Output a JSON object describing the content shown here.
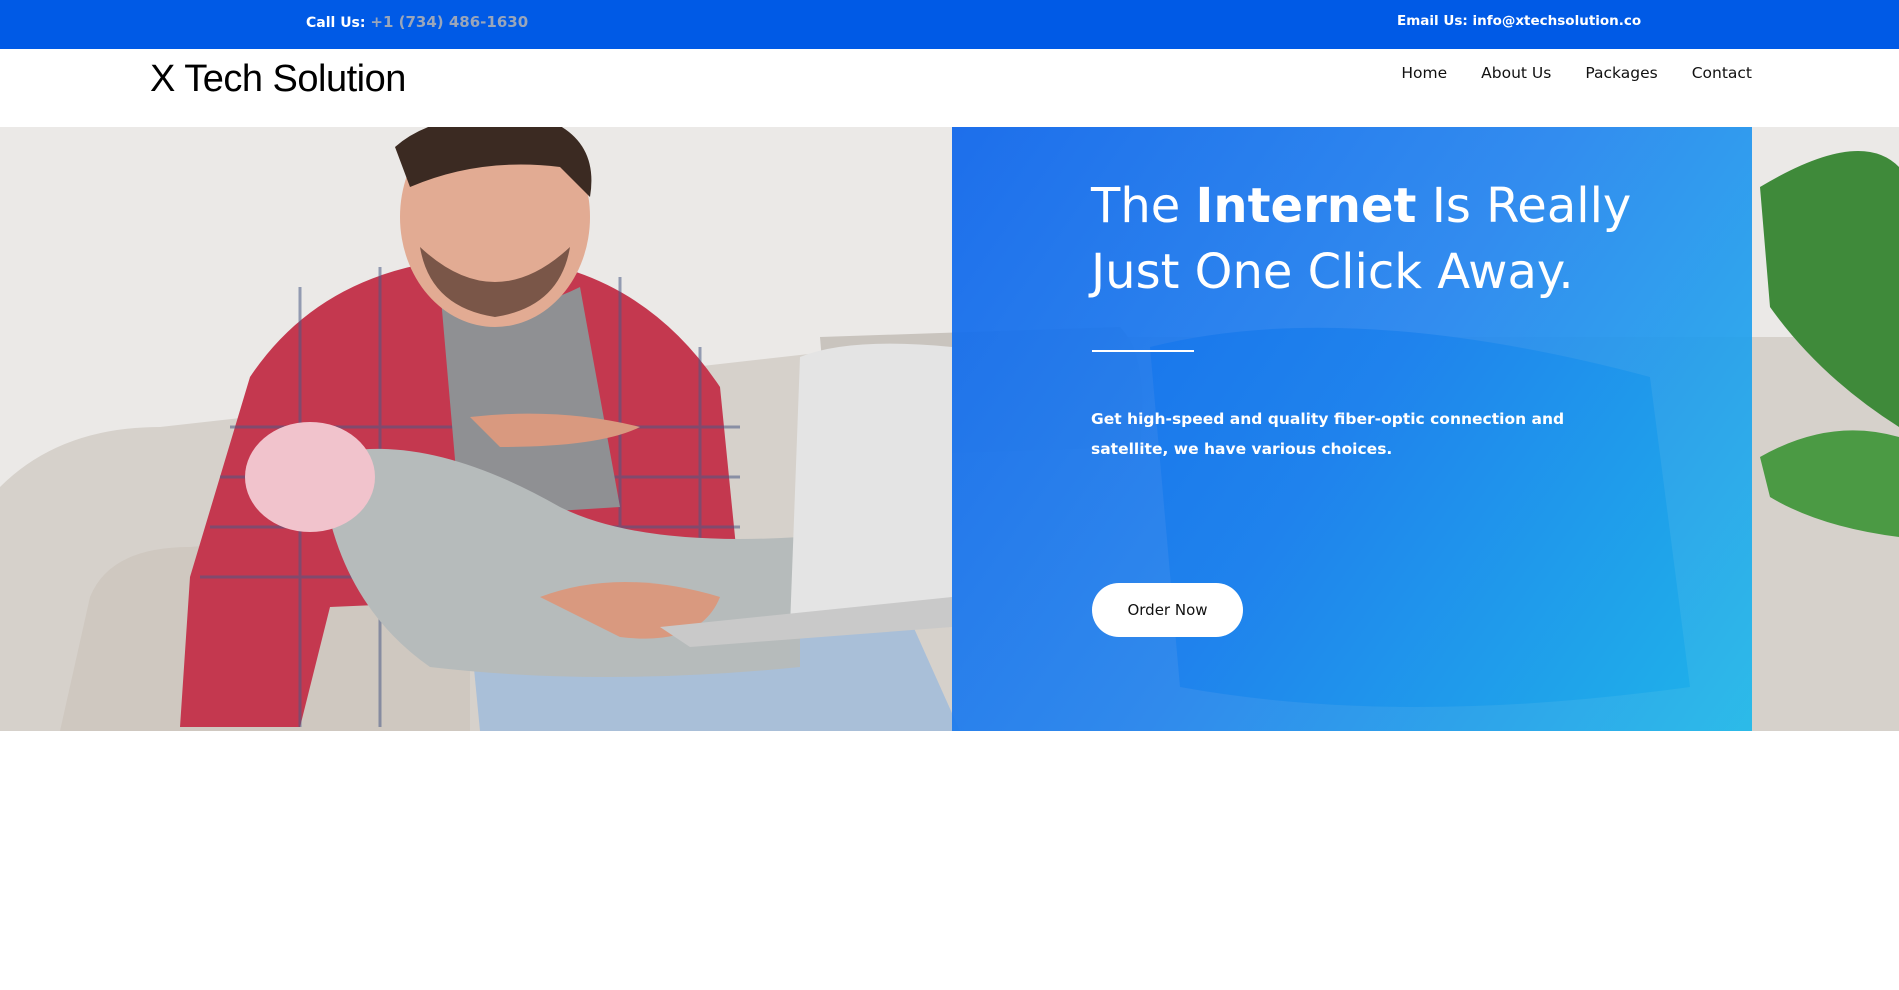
{
  "topbar": {
    "call_label": "Call Us:",
    "phone": "+1 (734) 486-1630",
    "email_label": "Email Us:",
    "email": "info@xtechsolution.co"
  },
  "header": {
    "logo": "X Tech Solution",
    "nav": [
      {
        "label": "Home"
      },
      {
        "label": "About Us"
      },
      {
        "label": "Packages"
      },
      {
        "label": "Contact"
      }
    ]
  },
  "hero": {
    "headline_pre": "The",
    "headline_bold": "Internet",
    "headline_post": "Is Really Just One Click Away.",
    "description": "Get high-speed and quality fiber-optic connection and satellite, we have various choices.",
    "cta_label": "Order Now"
  },
  "colors": {
    "topbar": "#005ae6",
    "panel": "#1a73e8",
    "phone": "#9aa6ba"
  }
}
